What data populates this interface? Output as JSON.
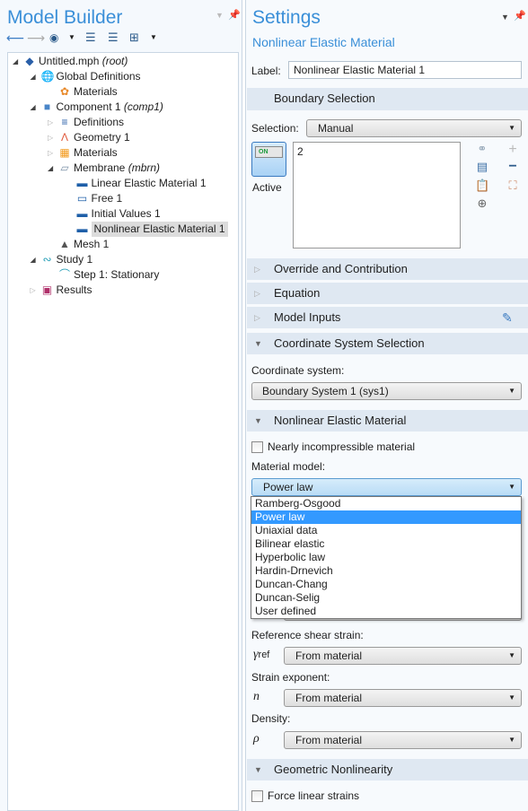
{
  "model_builder": {
    "title": "Model Builder",
    "toolbar": [
      {
        "icon": "arrow-left-icon"
      },
      {
        "icon": "arrow-right-icon"
      },
      {
        "icon": "eye-icon"
      },
      {
        "icon": "move-up-icon"
      },
      {
        "icon": "move-down-icon"
      },
      {
        "icon": "tree-layout-icon"
      }
    ],
    "tree": [
      {
        "label": "Untitled.mph",
        "suffix": "(root)",
        "level": 0,
        "expander": "expanded",
        "icon": "mph-file-icon",
        "color": "#2a5fa8"
      },
      {
        "label": "Global Definitions",
        "level": 1,
        "expander": "expanded",
        "icon": "globe-icon",
        "color": "#4a7fb8"
      },
      {
        "label": "Materials",
        "level": 2,
        "expander": "none",
        "icon": "global-materials-icon",
        "color": "#e8892a"
      },
      {
        "label": "Component 1",
        "suffix": "(comp1)",
        "level": 1,
        "expander": "expanded",
        "icon": "component-cube-icon",
        "color": "#4a86c8"
      },
      {
        "label": "Definitions",
        "level": 2,
        "expander": "collapsed",
        "icon": "definitions-icon",
        "color": "#2a5fa8"
      },
      {
        "label": "Geometry 1",
        "level": 2,
        "expander": "collapsed",
        "icon": "geometry-icon",
        "color": "#e0583a"
      },
      {
        "label": "Materials",
        "level": 2,
        "expander": "collapsed",
        "icon": "materials-icon",
        "color": "#f29a1e"
      },
      {
        "label": "Membrane",
        "suffix": "(mbrn)",
        "level": 2,
        "expander": "expanded",
        "icon": "membrane-icon",
        "color": "#7a8fa6"
      },
      {
        "label": "Linear Elastic Material 1",
        "level": 3,
        "expander": "none",
        "icon": "linear-elastic-icon",
        "color": "#1e5fa8"
      },
      {
        "label": "Free 1",
        "level": 3,
        "expander": "none",
        "icon": "free-icon",
        "color": "#1e5fa8"
      },
      {
        "label": "Initial Values 1",
        "level": 3,
        "expander": "none",
        "icon": "initial-values-icon",
        "color": "#1e5fa8"
      },
      {
        "label": "Nonlinear Elastic Material 1",
        "level": 3,
        "expander": "none",
        "icon": "nonlinear-elastic-icon",
        "color": "#1e5fa8",
        "selected": true
      },
      {
        "label": "Mesh 1",
        "level": 2,
        "expander": "none",
        "icon": "mesh-icon",
        "color": "#555555"
      },
      {
        "label": "Study 1",
        "level": 1,
        "expander": "expanded",
        "icon": "study-icon",
        "color": "#2aa0b8"
      },
      {
        "label": "Step 1: Stationary",
        "level": 2,
        "expander": "none",
        "icon": "stationary-step-icon",
        "color": "#2aa0b8"
      },
      {
        "label": "Results",
        "level": 1,
        "expander": "collapsed",
        "icon": "results-icon",
        "color": "#b0306a"
      }
    ]
  },
  "settings": {
    "title": "Settings",
    "subtitle": "Nonlinear Elastic Material",
    "label_caption": "Label:",
    "label_value": "Nonlinear Elastic Material 1",
    "boundary_selection": {
      "header": "Boundary Selection",
      "selection_caption": "Selection:",
      "selection_value": "Manual",
      "active_label": "Active",
      "toggle_text": "ON",
      "selected_entities": "2"
    },
    "collapsed_sections": [
      "Override and Contribution",
      "Equation",
      "Model Inputs"
    ],
    "coordinate": {
      "header": "Coordinate System Selection",
      "caption": "Coordinate system:",
      "value": "Boundary System 1 (sys1)"
    },
    "nonlinear": {
      "header": "Nonlinear Elastic Material",
      "nearly_incompressible": "Nearly incompressible material",
      "nearly_incompressible_checked": false,
      "material_model_caption": "Material model:",
      "material_model_value": "Power law",
      "options": [
        "Ramberg-Osgood",
        "Power law",
        "Uniaxial data",
        "Bilinear elastic",
        "Hyperbolic law",
        "Hardin-Drnevich",
        "Duncan-Chang",
        "Duncan-Selig",
        "User defined"
      ],
      "highlighted_option": "Power law",
      "ref_shear_caption": "Reference shear strain:",
      "ref_shear_symbol": "γ",
      "ref_shear_sub": "ref",
      "ref_shear_value": "From material",
      "exponent_caption": "Strain exponent:",
      "exponent_symbol": "n",
      "exponent_value": "From material",
      "density_caption": "Density:",
      "density_symbol": "ρ",
      "density_value": "From material"
    },
    "geometric": {
      "header": "Geometric Nonlinearity",
      "force_linear": "Force linear strains",
      "force_linear_checked": false
    },
    "accent": "#3a8fd8",
    "header_bg": "#dfe8f2",
    "highlight": "#3399ff"
  }
}
